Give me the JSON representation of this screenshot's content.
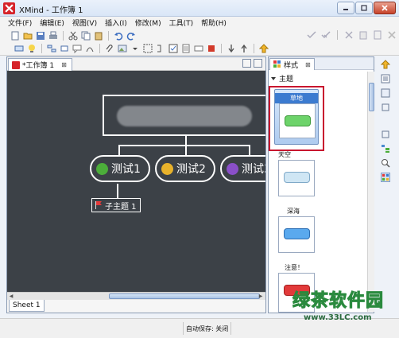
{
  "window": {
    "title": "XMind - 工作簿 1"
  },
  "menu": [
    "文件(F)",
    "编辑(E)",
    "视图(V)",
    "插入(I)",
    "修改(M)",
    "工具(T)",
    "帮助(H)"
  ],
  "editor": {
    "tab_label": "*工作簿 1",
    "tab_close": "⊠",
    "topics": [
      {
        "label": "测试1",
        "emoji": "green-smile",
        "color": "#4cae3a"
      },
      {
        "label": "测试2",
        "emoji": "yellow-grin",
        "color": "#e8b22b"
      },
      {
        "label": "测试3",
        "emoji": "purple-surprised",
        "color": "#8a4fc9"
      }
    ],
    "subtopic_label": "子主题 1",
    "sheet_tab": "Sheet 1",
    "scroll_center": "▯▯▯"
  },
  "styles_panel": {
    "tab_label": "样式",
    "tab_close": "⊠",
    "group_label": "主题",
    "styles": [
      {
        "name": "草地",
        "button_color": "#6dd36a"
      },
      {
        "name": "天空",
        "button_color": "#cfe6f4"
      },
      {
        "name": "深海",
        "button_color": "#5aa9ee"
      },
      {
        "name": "注意！",
        "button_color": "#e23a3a"
      }
    ]
  },
  "status": {
    "autosave": "自动保存: 关闭"
  },
  "watermark": {
    "main": "绿茶软件园",
    "url": "www.33LC.com"
  }
}
